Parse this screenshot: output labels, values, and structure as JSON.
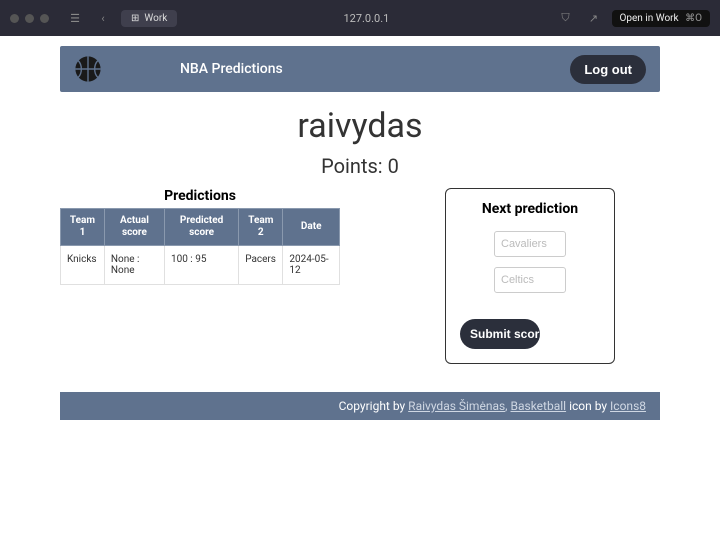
{
  "chrome": {
    "tab_label": "Work",
    "address": "127.0.0.1",
    "open_in": "Open in Work",
    "shortcut": "⌘O"
  },
  "header": {
    "brand": "NBA Predictions",
    "logout": "Log out"
  },
  "user": {
    "name": "raivydas",
    "points_label": "Points: 0"
  },
  "predictions": {
    "title": "Predictions",
    "columns": [
      "Team 1",
      "Actual score",
      "Predicted score",
      "Team 2",
      "Date"
    ],
    "rows": [
      {
        "team1": "Knicks",
        "actual": "None : None",
        "predicted": "100 : 95",
        "team2": "Pacers",
        "date": "2024-05-12"
      }
    ]
  },
  "next": {
    "title": "Next prediction",
    "team1_placeholder": "Cavaliers",
    "team2_placeholder": "Celtics",
    "submit": "Submit scores"
  },
  "footer": {
    "prefix": "Copyright by ",
    "author": "Raivydas Šimėnas",
    "mid": "Basketball",
    "icon_by": " icon by ",
    "icons8": "Icons8"
  }
}
